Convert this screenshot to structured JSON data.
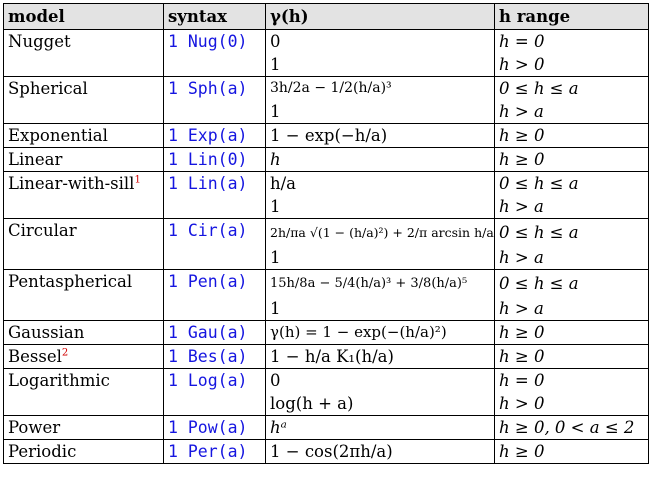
{
  "headers": {
    "model": "model",
    "syntax": "syntax",
    "gamma": "γ(h)",
    "range": "h range"
  },
  "footnote_marks": {
    "linear_with_sill": "1",
    "bessel": "2"
  },
  "rows": [
    {
      "model": "Nugget",
      "syntax": "1 Nug(0)",
      "g": [
        "0",
        "1"
      ],
      "r": [
        "h = 0",
        "h > 0"
      ]
    },
    {
      "model": "Spherical",
      "syntax": "1 Sph(a)",
      "g": [
        "3h/2a − 1/2(h/a)³",
        "1"
      ],
      "r": [
        "0 ≤ h ≤ a",
        "h > a"
      ]
    },
    {
      "model": "Exponential",
      "syntax": "1 Exp(a)",
      "g": [
        "1 − exp(−h/a)"
      ],
      "r": [
        "h ≥ 0"
      ]
    },
    {
      "model": "Linear",
      "syntax": "1 Lin(0)",
      "g": [
        "h"
      ],
      "r": [
        "h ≥ 0"
      ]
    },
    {
      "model": "Linear-with-sill",
      "syntax": "1 Lin(a)",
      "g": [
        "h/a",
        "1"
      ],
      "r": [
        "0 ≤ h ≤ a",
        "h > a"
      ]
    },
    {
      "model": "Circular",
      "syntax": "1 Cir(a)",
      "g": [
        "2h/πa √(1 − (h/a)²) + 2/π arcsin h/a",
        "1"
      ],
      "r": [
        "0 ≤ h ≤ a",
        "h > a"
      ]
    },
    {
      "model": "Pentaspherical",
      "syntax": "1 Pen(a)",
      "g": [
        "15h/8a − 5/4(h/a)³ + 3/8(h/a)⁵",
        "1"
      ],
      "r": [
        "0 ≤ h ≤ a",
        "h > a"
      ]
    },
    {
      "model": "Gaussian",
      "syntax": "1 Gau(a)",
      "g": [
        "γ(h) = 1 − exp(−(h/a)²)"
      ],
      "r": [
        "h ≥ 0"
      ]
    },
    {
      "model": "Bessel",
      "syntax": "1 Bes(a)",
      "g": [
        "1 − h/a K₁(h/a)"
      ],
      "r": [
        "h ≥ 0"
      ]
    },
    {
      "model": "Logarithmic",
      "syntax": "1 Log(a)",
      "g": [
        "0",
        "log(h + a)"
      ],
      "r": [
        "h = 0",
        "h > 0"
      ]
    },
    {
      "model": "Power",
      "syntax": "1 Pow(a)",
      "g": [
        "hᵃ"
      ],
      "r": [
        "h ≥ 0, 0 < a ≤ 2"
      ]
    },
    {
      "model": "Periodic",
      "syntax": "1 Per(a)",
      "g": [
        "1 − cos(2πh/a)"
      ],
      "r": [
        "h ≥ 0"
      ]
    }
  ]
}
